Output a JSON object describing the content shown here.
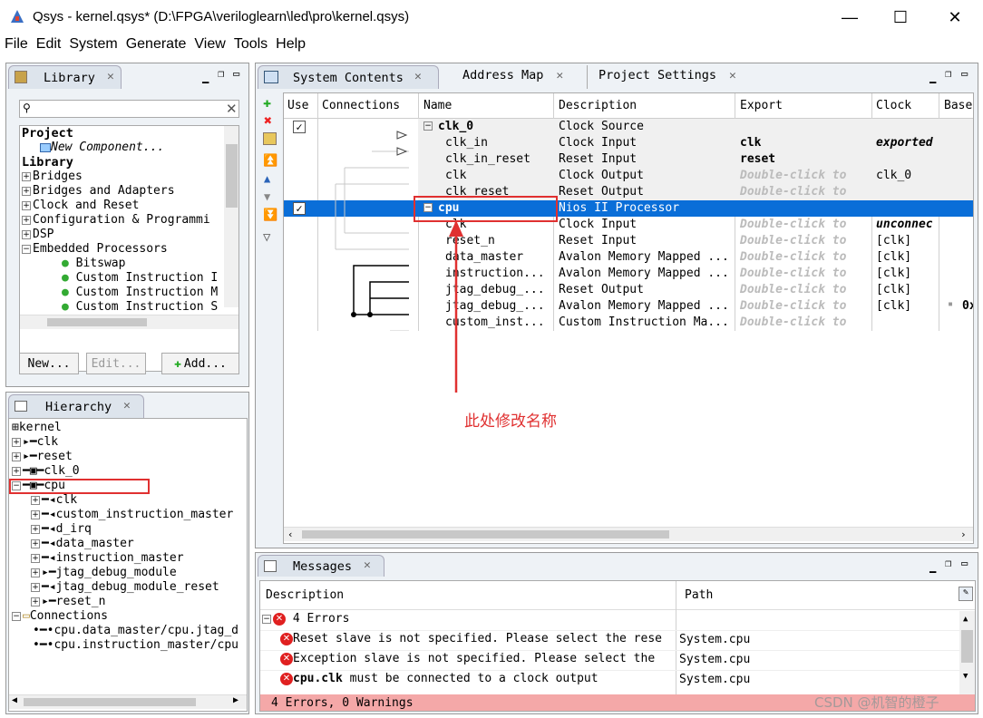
{
  "window": {
    "title": "Qsys - kernel.qsys* (D:\\FPGA\\veriloglearn\\led\\pro\\kernel.qsys)",
    "min": "—",
    "max": "☐",
    "close": "✕"
  },
  "menu": [
    "File",
    "Edit",
    "System",
    "Generate",
    "View",
    "Tools",
    "Help"
  ],
  "library": {
    "title": "Library",
    "search_placeholder": "",
    "project_label": "Project",
    "new_component": "New Component...",
    "library_label": "Library",
    "items": [
      "Bridges",
      "Bridges and Adapters",
      "Clock and Reset",
      "Configuration & Programmi",
      "DSP",
      "Embedded Processors"
    ],
    "sub_items": [
      "Bitswap",
      "Custom Instruction I",
      "Custom Instruction M",
      "Custom Instruction S"
    ],
    "buttons": {
      "new": "New...",
      "edit": "Edit...",
      "add": "Add..."
    }
  },
  "hierarchy": {
    "title": "Hierarchy",
    "root": "kernel",
    "top": [
      "clk",
      "reset",
      "clk_0",
      "cpu"
    ],
    "cpu_children": [
      "clk",
      "custom_instruction_master",
      "d_irq",
      "data_master",
      "instruction_master",
      "jtag_debug_module",
      "jtag_debug_module_reset",
      "reset_n"
    ],
    "connections_label": "Connections",
    "connections": [
      "cpu.data_master/cpu.jtag_d",
      "cpu.instruction_master/cpu"
    ]
  },
  "tabs": {
    "system_contents": "System Contents",
    "address_map": "Address Map",
    "project_settings": "Project Settings"
  },
  "table": {
    "headers": {
      "use": "Use",
      "connections": "Connections",
      "name": "Name",
      "description": "Description",
      "export": "Export",
      "clock": "Clock",
      "base": "Base"
    },
    "rows": [
      {
        "name": "clk_0",
        "desc": "Clock Source",
        "export": "",
        "clock": "",
        "base": ""
      },
      {
        "name": "clk_in",
        "desc": "Clock Input",
        "export": "clk",
        "clock": "exported",
        "base": ""
      },
      {
        "name": "clk_in_reset",
        "desc": "Reset Input",
        "export": "reset",
        "clock": "",
        "base": ""
      },
      {
        "name": "clk",
        "desc": "Clock Output",
        "export": "Double-click to",
        "clock": "clk_0",
        "base": ""
      },
      {
        "name": "clk_reset",
        "desc": "Reset Output",
        "export": "Double-click to",
        "clock": "",
        "base": ""
      },
      {
        "name": "cpu",
        "desc": "Nios II Processor",
        "export": "",
        "clock": "",
        "base": ""
      },
      {
        "name": "clk",
        "desc": "Clock Input",
        "export": "Double-click to",
        "clock": "unconnec",
        "base": ""
      },
      {
        "name": "reset_n",
        "desc": "Reset Input",
        "export": "Double-click to",
        "clock": "[clk]",
        "base": ""
      },
      {
        "name": "data_master",
        "desc": "Avalon Memory Mapped ...",
        "export": "Double-click to",
        "clock": "[clk]",
        "base": ""
      },
      {
        "name": "instruction...",
        "desc": "Avalon Memory Mapped ...",
        "export": "Double-click to",
        "clock": "[clk]",
        "base": ""
      },
      {
        "name": "jtag_debug_...",
        "desc": "Reset Output",
        "export": "Double-click to",
        "clock": "[clk]",
        "base": ""
      },
      {
        "name": "jtag_debug_...",
        "desc": "Avalon Memory Mapped ...",
        "export": "Double-click to",
        "clock": "[clk]",
        "base": "0x"
      },
      {
        "name": "custom_inst...",
        "desc": "Custom Instruction Ma...",
        "export": "Double-click to",
        "clock": "",
        "base": ""
      }
    ]
  },
  "annotation": {
    "text": "此处修改名称",
    "color": "#e03030"
  },
  "messages": {
    "title": "Messages",
    "headers": {
      "description": "Description",
      "path": "Path"
    },
    "group": "4 Errors",
    "items": [
      {
        "desc": "Reset slave is not specified. Please select the rese",
        "path": "System.cpu"
      },
      {
        "desc": "Exception slave is not specified. Please select the",
        "path": "System.cpu"
      },
      {
        "desc_bold": "cpu.clk",
        "desc_rest": " must be connected to a clock output",
        "path": "System.cpu"
      }
    ],
    "status": "4 Errors, 0 Warnings"
  },
  "watermark": "CSDN @机智的橙子",
  "colors": {
    "selection": "#0a6ed8",
    "highlight_box": "#e03030",
    "status_bar": "#f4a8a8"
  }
}
